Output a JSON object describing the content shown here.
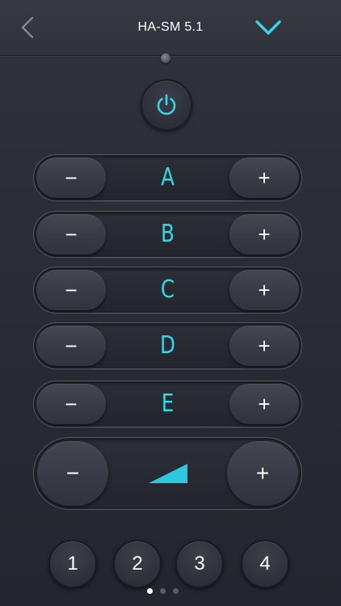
{
  "header": {
    "title": "HA-SM 5.1",
    "back_icon": "chevron-left-icon",
    "dropdown_icon": "chevron-down-icon",
    "accent_color": "#33d7e8"
  },
  "power": {
    "icon": "power-icon"
  },
  "zones": [
    {
      "label": "A",
      "minus": "−",
      "plus": "+"
    },
    {
      "label": "B",
      "minus": "−",
      "plus": "+"
    },
    {
      "label": "C",
      "minus": "−",
      "plus": "+"
    },
    {
      "label": "D",
      "minus": "−",
      "plus": "+"
    },
    {
      "label": "E",
      "minus": "−",
      "plus": "+"
    }
  ],
  "volume": {
    "minus": "−",
    "plus": "+",
    "icon": "volume-ramp-icon"
  },
  "presets": [
    "1",
    "2",
    "3",
    "4"
  ],
  "pagination": {
    "total": 3,
    "active": 1
  }
}
